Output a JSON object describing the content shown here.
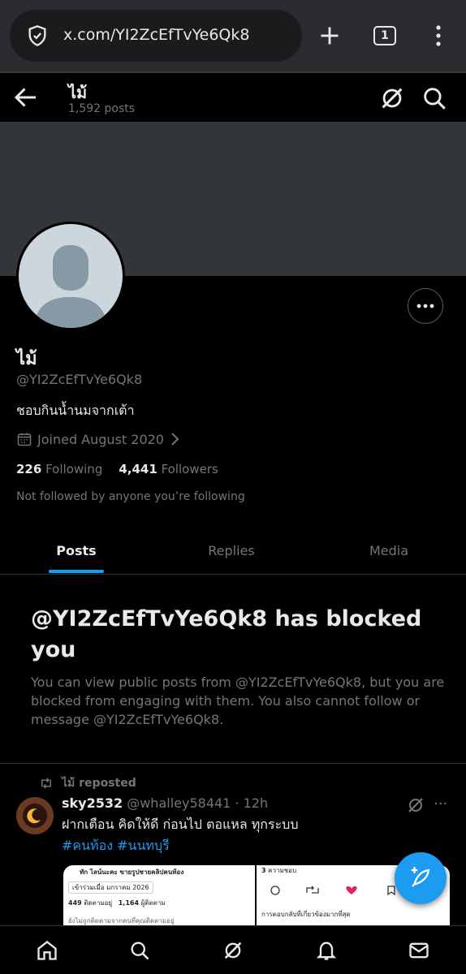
{
  "browser": {
    "url": "x.com/YI2ZcEfTvYe6Qk8",
    "tab_count": "1"
  },
  "header": {
    "name": "ไม้",
    "post_count": "1,592 posts"
  },
  "profile": {
    "display_name": "ไม้",
    "handle": "@YI2ZcEfTvYe6Qk8",
    "bio": "ชอบกินน้ำนมจากเต้า",
    "joined": "Joined August 2020",
    "following_count": "226",
    "following_label": "Following",
    "followers_count": "4,441",
    "followers_label": "Followers",
    "not_followed": "Not followed by anyone you’re following"
  },
  "tabs": [
    {
      "label": "Posts",
      "active": true
    },
    {
      "label": "Replies",
      "active": false
    },
    {
      "label": "Media",
      "active": false
    }
  ],
  "blocked": {
    "title": "@YI2ZcEfTvYe6Qk8 has blocked you",
    "text": "You can view public posts from @YI2ZcEfTvYe6Qk8, but you are blocked from engaging with them. You also cannot follow or message @YI2ZcEfTvYe6Qk8."
  },
  "post": {
    "repost_label": "ไม้ reposted",
    "author_name": "sky2532",
    "author_meta": "@whalley58441 · 12h",
    "text": "ฝากเตือน คิดให้ดี ก่อนไป ตอแหล ทุกระบบ",
    "hashtags": "#คนท้อง #นนทบุรี",
    "more": "···",
    "media": {
      "left_line1": "ทัก ไลน์นะคะ ขายรูปชายคลิปคนท้อง",
      "left_line2": "เข้าร่วมเมื่อ มกราคม 2026",
      "left_following": "449",
      "left_following_label": "ติดตามอยู่",
      "left_followers": "1,164",
      "left_followers_label": "ผู้ติดตาม",
      "left_line4": "ยังไม่ถูกติดตามจากคนที่คุณติดตามอยู่",
      "right_likes": "3",
      "right_likes_label": "ความชอบ",
      "right_line2": "การตอบกลับที่เกี่ยวข้องมากที่สุด"
    }
  },
  "colors": {
    "accent": "#1d9bf0",
    "background": "#000000",
    "muted": "#71767b",
    "banner": "#333639"
  },
  "icons": {
    "shield": "shield-icon",
    "plus": "plus-icon",
    "menu": "kebab-menu-icon",
    "back": "back-arrow-icon",
    "grok": "grok-icon",
    "search": "search-icon",
    "calendar": "calendar-icon",
    "chevron": "chevron-right-icon",
    "repost": "repost-icon",
    "compose": "compose-icon",
    "home": "home-icon",
    "bell": "bell-icon",
    "mail": "mail-icon"
  }
}
